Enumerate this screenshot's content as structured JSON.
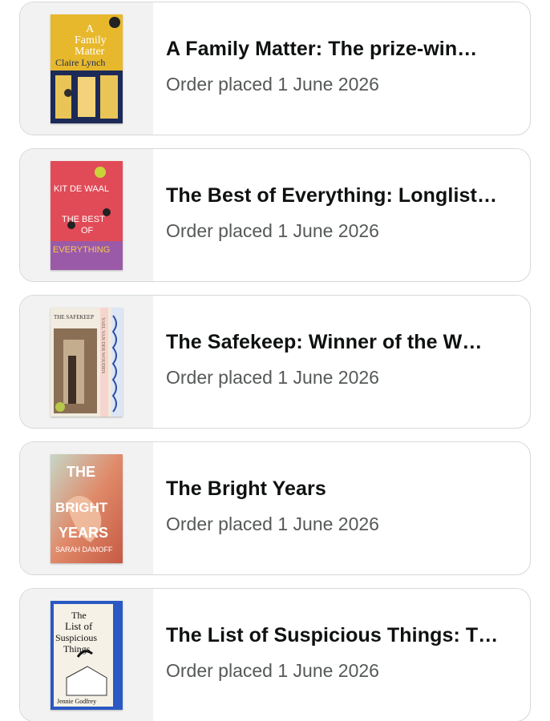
{
  "orders": [
    {
      "title": "A Family Matter: The prize-win…",
      "date": "Order placed 1 June 2026",
      "cover": {
        "author": "Claire Lynch",
        "line1": "A",
        "line2": "Family",
        "line3": "Matter",
        "bg": "#e7b82c",
        "accent": "#1d2a57"
      }
    },
    {
      "title": "The Best of Everything: Longlist…",
      "date": "Order placed 1 June 2026",
      "cover": {
        "author": "KIT DE WAAL",
        "line1": "THE BEST",
        "line2": "OF",
        "line3": "EVERYTHING",
        "bg": "#e14b57",
        "accent": "#7f4aa0"
      }
    },
    {
      "title": "The Safekeep: Winner of the W…",
      "date": "Order placed 1 June 2026",
      "cover": {
        "author": "YAEL VAN DER WOUDEN",
        "line1": "THE SAFEKEEP",
        "bg": "#f1ebe0",
        "accent": "#7b6a55"
      }
    },
    {
      "title": "The Bright Years",
      "date": "Order placed 1 June 2026",
      "cover": {
        "author": "SARAH DAMOFF",
        "line1": "THE",
        "line2": "BRIGHT",
        "line3": "YEARS",
        "bg": "#d9755c",
        "accent": "#5a7f6a"
      }
    },
    {
      "title": "The List of Suspicious Things: T…",
      "date": "Order placed 1 June 2026",
      "cover": {
        "author": "Jennie Godfrey",
        "line1": "The",
        "line2": "List of",
        "line3": "Suspicious",
        "line4": "Things",
        "bg": "#f5f1e6",
        "accent": "#2b59c3"
      }
    }
  ]
}
